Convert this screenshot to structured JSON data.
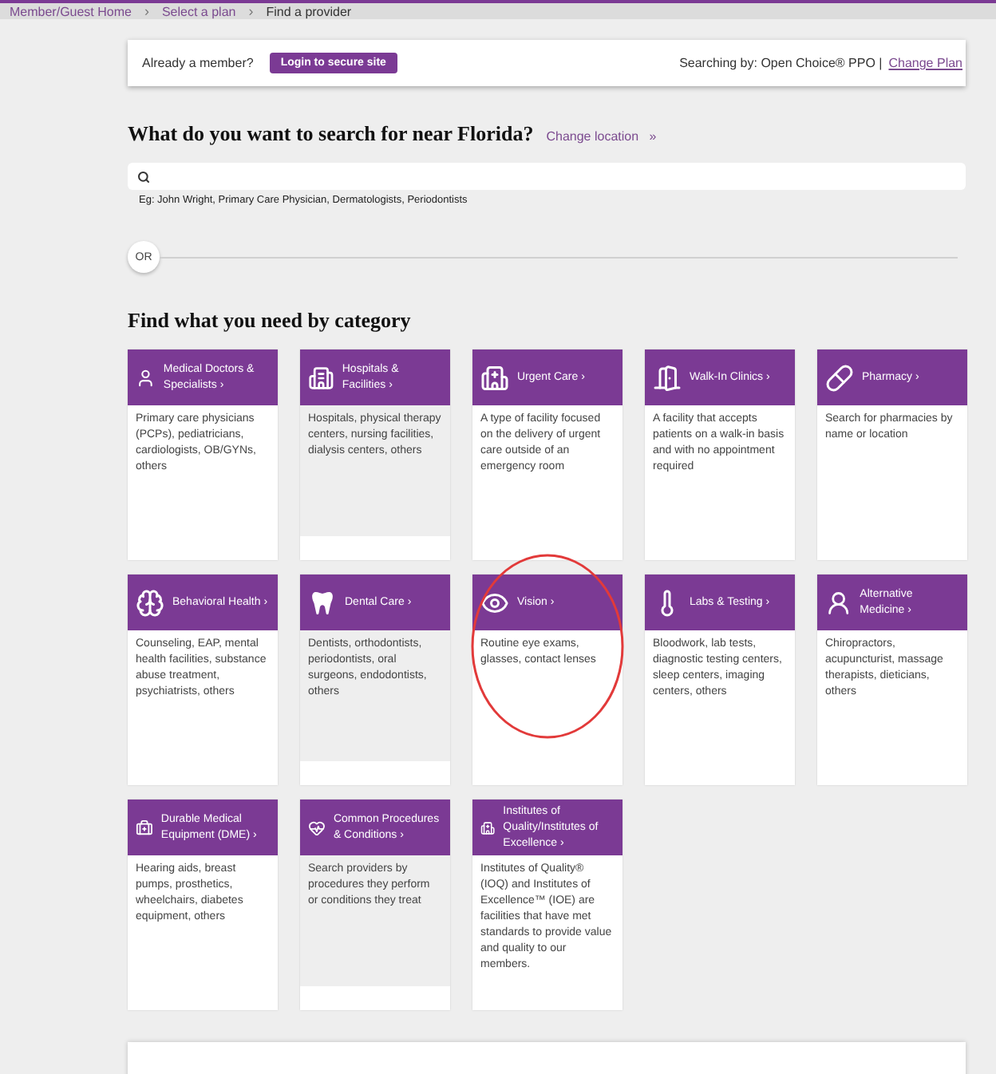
{
  "breadcrumbs": [
    {
      "label": "Member/Guest Home",
      "current": false
    },
    {
      "label": "Select a plan",
      "current": false
    },
    {
      "label": "Find a provider",
      "current": true
    }
  ],
  "member_bar": {
    "prompt": "Already a member?",
    "login_button": "Login to secure site",
    "searching_by": "Searching by: Open Choice® PPO",
    "separator": "|",
    "change_plan": "Change Plan"
  },
  "search": {
    "heading": "What do you want to search for near Florida?",
    "change_location": "Change location",
    "change_location_arrow": "»",
    "example": "Eg: John Wright, Primary Care Physician, Dermatologists, Periodontists"
  },
  "divider_label": "OR",
  "categories_heading": "Find what you need by category",
  "categories": [
    {
      "title": "Medical Doctors & Specialists",
      "description": "Primary care physicians (PCPs), pediatricians, cardiologists, OB/GYNs, others",
      "shaded": false,
      "circled": false
    },
    {
      "title": "Hospitals & Facilities",
      "description": "Hospitals, physical therapy centers, nursing facilities, dialysis centers, others",
      "shaded": true,
      "circled": false
    },
    {
      "title": "Urgent Care",
      "description": "A type of facility focused on the delivery of urgent care outside of an emergency room",
      "shaded": false,
      "circled": false
    },
    {
      "title": "Walk-In Clinics",
      "description": "A facility that accepts patients on a walk-in basis and with no appointment required",
      "shaded": false,
      "circled": false
    },
    {
      "title": "Pharmacy",
      "description": "Search for pharmacies by name or location",
      "shaded": false,
      "circled": false
    },
    {
      "title": "Behavioral Health",
      "description": "Counseling, EAP, mental health facilities, substance abuse treatment, psychiatrists, others",
      "shaded": false,
      "circled": false
    },
    {
      "title": "Dental Care",
      "description": "Dentists, orthodontists, periodontists, oral surgeons, endodontists, others",
      "shaded": true,
      "circled": false
    },
    {
      "title": "Vision",
      "description": "Routine eye exams, glasses, contact lenses",
      "shaded": false,
      "circled": true
    },
    {
      "title": "Labs & Testing",
      "description": "Bloodwork, lab tests, diagnostic testing centers, sleep centers, imaging centers, others",
      "shaded": false,
      "circled": false
    },
    {
      "title": "Alternative Medicine",
      "description": "Chiropractors, acupuncturist, massage therapists, dieticians, others",
      "shaded": false,
      "circled": false
    },
    {
      "title": "Durable Medical Equipment (DME)",
      "description": "Hearing aids, breast pumps, prosthetics, wheelchairs, diabetes equipment, others",
      "shaded": false,
      "circled": false
    },
    {
      "title": "Common Procedures & Conditions",
      "description": "Search providers by procedures they perform or conditions they treat",
      "shaded": true,
      "circled": false
    },
    {
      "title": "Institutes of Quality/Institutes of Excellence",
      "description": "Institutes of Quality® (IOQ) and Institutes of Excellence™ (IOE) are facilities that have met standards to provide value and quality to our members.",
      "shaded": false,
      "circled": false
    }
  ],
  "chevron": "›"
}
